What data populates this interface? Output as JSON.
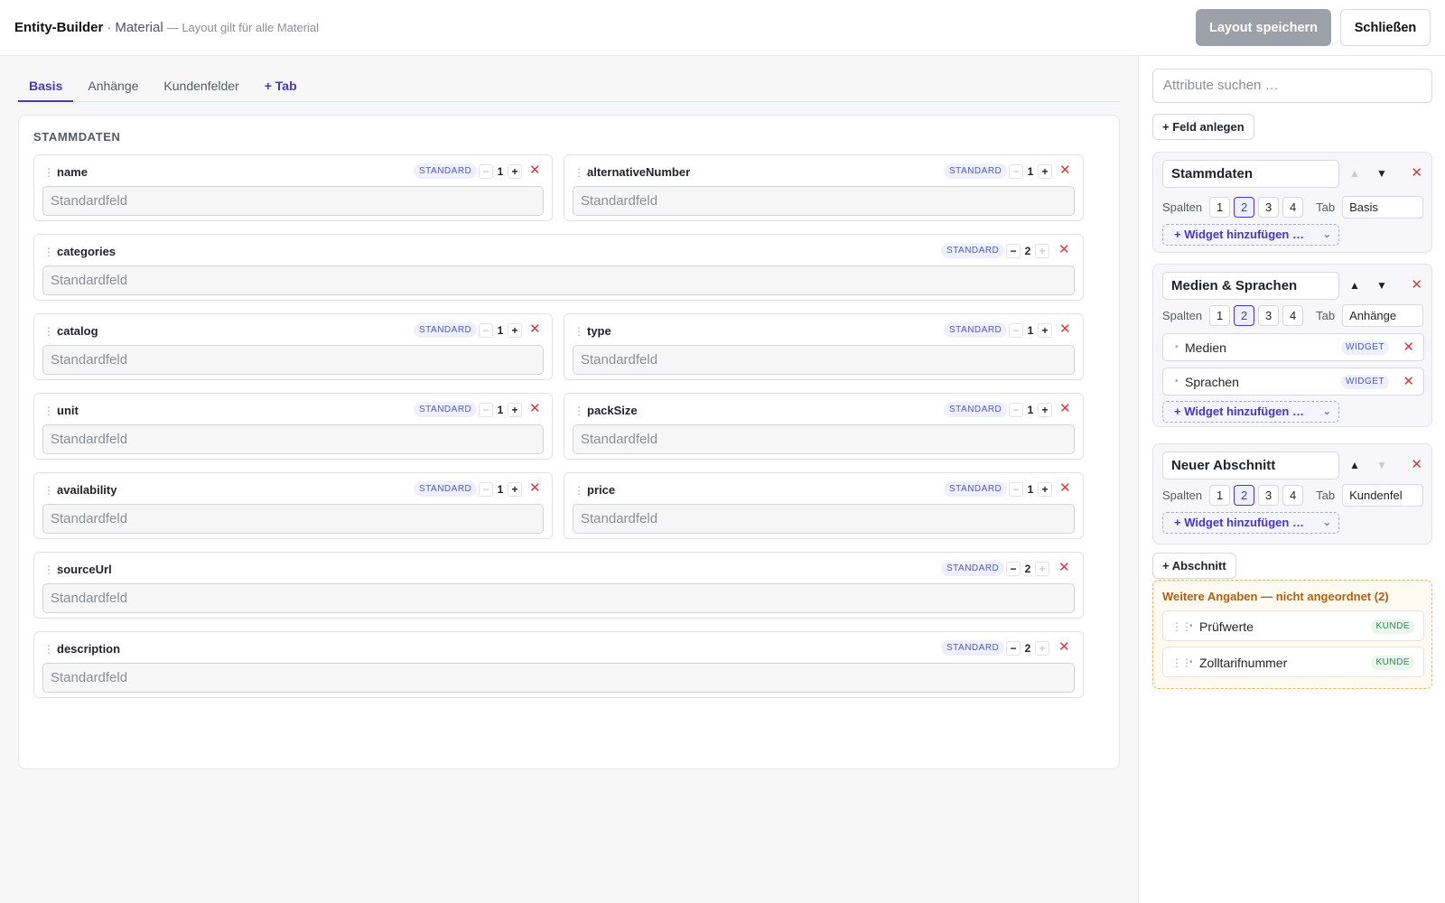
{
  "header": {
    "title": "Entity-Builder",
    "separator": "·",
    "entity": "Material",
    "subtitle": "— Layout gilt für alle Material",
    "save_label": "Layout speichern",
    "close_label": "Schließen"
  },
  "tabs": [
    {
      "label": "Basis",
      "active": true
    },
    {
      "label": "Anhänge",
      "active": false
    },
    {
      "label": "Kundenfelder",
      "active": false
    }
  ],
  "add_tab_label": "+ Tab",
  "section": {
    "title": "STAMMDATEN",
    "placeholder": "Standardfeld",
    "fields": [
      {
        "name": "name",
        "badge": "STANDARD",
        "width": "1"
      },
      {
        "name": "alternativeNumber",
        "badge": "STANDARD",
        "width": "1"
      },
      {
        "name": "categories",
        "badge": "STANDARD",
        "width": "2"
      },
      {
        "name": "catalog",
        "badge": "STANDARD",
        "width": "1"
      },
      {
        "name": "type",
        "badge": "STANDARD",
        "width": "1"
      },
      {
        "name": "unit",
        "badge": "STANDARD",
        "width": "1"
      },
      {
        "name": "packSize",
        "badge": "STANDARD",
        "width": "1"
      },
      {
        "name": "availability",
        "badge": "STANDARD",
        "width": "1"
      },
      {
        "name": "price",
        "badge": "STANDARD",
        "width": "1"
      },
      {
        "name": "sourceUrl",
        "badge": "STANDARD",
        "width": "2"
      },
      {
        "name": "description",
        "badge": "STANDARD",
        "width": "2"
      }
    ]
  },
  "sidebar": {
    "search_placeholder": "Attribute suchen …",
    "add_field_label": "+ Feld anlegen",
    "columns_label": "Spalten",
    "tab_label": "Tab",
    "column_options": [
      "1",
      "2",
      "3",
      "4"
    ],
    "widget_add_label": "+ Widget hinzufügen …",
    "cards": [
      {
        "name": "Stammdaten",
        "selected_columns": "2",
        "tab": "Basis",
        "widgets": []
      },
      {
        "name": "Medien & Sprachen",
        "selected_columns": "2",
        "tab": "Anhänge",
        "widgets": [
          {
            "name": "Medien",
            "badge": "WIDGET"
          },
          {
            "name": "Sprachen",
            "badge": "WIDGET"
          }
        ]
      },
      {
        "name": "Neuer Abschnitt",
        "selected_columns": "2",
        "tab": "Kundenfel",
        "widgets": []
      }
    ],
    "add_section_label": "+ Abschnitt",
    "unassigned": {
      "title": "Weitere Angaben — nicht angeordnet (2)",
      "items": [
        {
          "name": "Prüfwerte",
          "badge": "KUNDE"
        },
        {
          "name": "Zolltarifnummer",
          "badge": "KUNDE"
        }
      ]
    }
  },
  "colors": {
    "accent": "#4338ca",
    "danger": "#d23c3c",
    "warning": "#b06014",
    "customer_badge": "#2f8a4a"
  }
}
